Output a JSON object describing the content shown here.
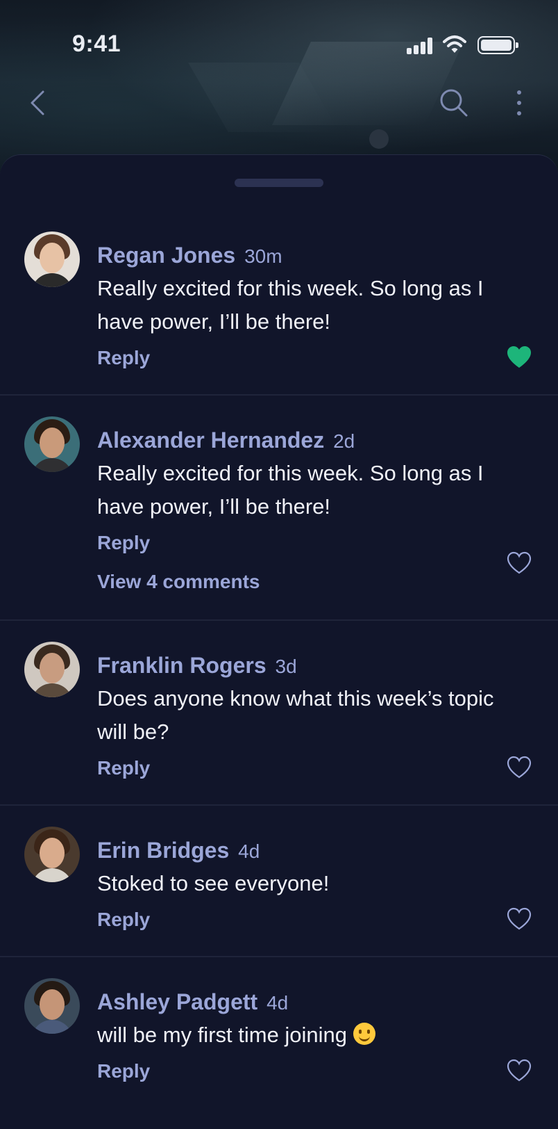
{
  "status_bar": {
    "time": "9:41"
  },
  "nav": {
    "back": "back-icon",
    "search": "search-icon",
    "more": "more-icon"
  },
  "colors": {
    "accent": "#9ba6d8",
    "liked": "#1db57a",
    "background": "#11152a"
  },
  "comments": [
    {
      "name": "Regan Jones",
      "time": "30m",
      "text": "Really excited for this week. So long as I have power, I’ll be there!",
      "reply": "Reply",
      "liked": true
    },
    {
      "name": "Alexander Hernandez",
      "time": "2d",
      "text": "Really excited for this week. So long as I have power, I’ll be there!",
      "reply": "Reply",
      "view": "View 4 comments",
      "liked": false
    },
    {
      "name": "Franklin Rogers",
      "time": "3d",
      "text": "Does anyone know what this week’s topic will be?",
      "reply": "Reply",
      "liked": false
    },
    {
      "name": "Erin Bridges",
      "time": "4d",
      "text": "Stoked to see everyone!",
      "reply": "Reply",
      "liked": false
    },
    {
      "name": "Ashley Padgett",
      "time": "4d",
      "text": "will be my first time joining",
      "emoji": "smiling-face-emoji",
      "reply": "Reply",
      "liked": false
    }
  ]
}
